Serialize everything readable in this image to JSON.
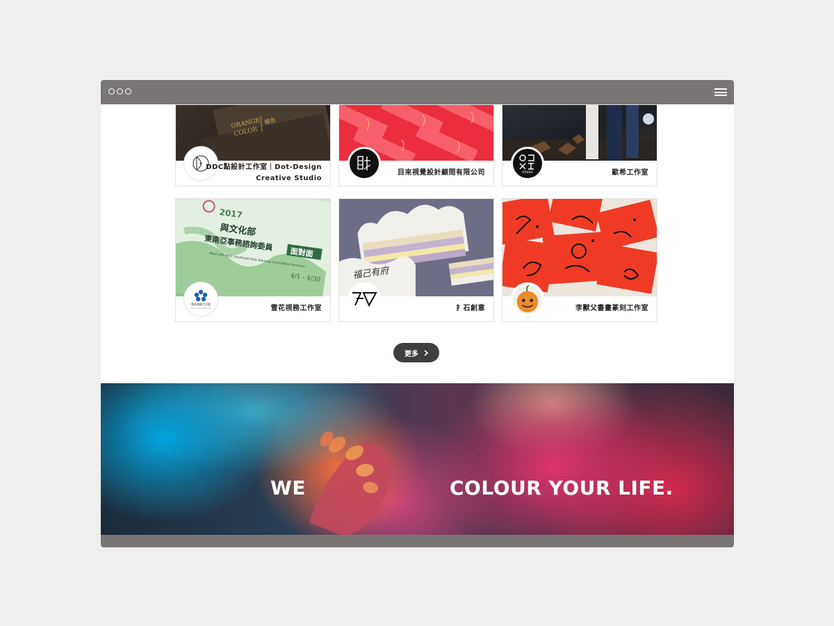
{
  "cards": [
    {
      "name_lines": [
        "DDC點設計工作室｜Dot-Design",
        "Creative Studio"
      ]
    },
    {
      "name_lines": [
        "目來視覺設計顧問有限公司"
      ]
    },
    {
      "name_lines": [
        "歐希工作室"
      ]
    },
    {
      "name_lines": [
        "雪花視務工作室"
      ]
    },
    {
      "name_lines": [
        "扌石創意"
      ]
    },
    {
      "name_lines": [
        "李獸父書畫篆刻工作室"
      ]
    }
  ],
  "card_images": {
    "orange_color": {
      "line1": "ORANGE",
      "line2": "COLOR",
      "cn": "橘色"
    },
    "snow": {
      "year": "2017",
      "title1": "與文化部",
      "title2": "東南亞事務諮詢委員",
      "title3": "面對面",
      "sub": "Meet with MOC Southeast Asia Advisory Committee Members",
      "date": "4/1 - 4/30",
      "logo_text": "雪花視務工作室",
      "logo_sub": "snow-visual-design.tw"
    },
    "cake": {
      "script": "福己有府"
    },
    "ohi": {
      "logo_text": "OHI",
      "studio": "STUDIO"
    }
  },
  "more_button": {
    "label": "更多"
  },
  "banner": {
    "text_left": "WE",
    "text_right": "COLOUR YOUR LIFE."
  },
  "colors": {
    "titlebar": "#7a7676",
    "button": "#3f3f3f",
    "background": "#efefef"
  }
}
